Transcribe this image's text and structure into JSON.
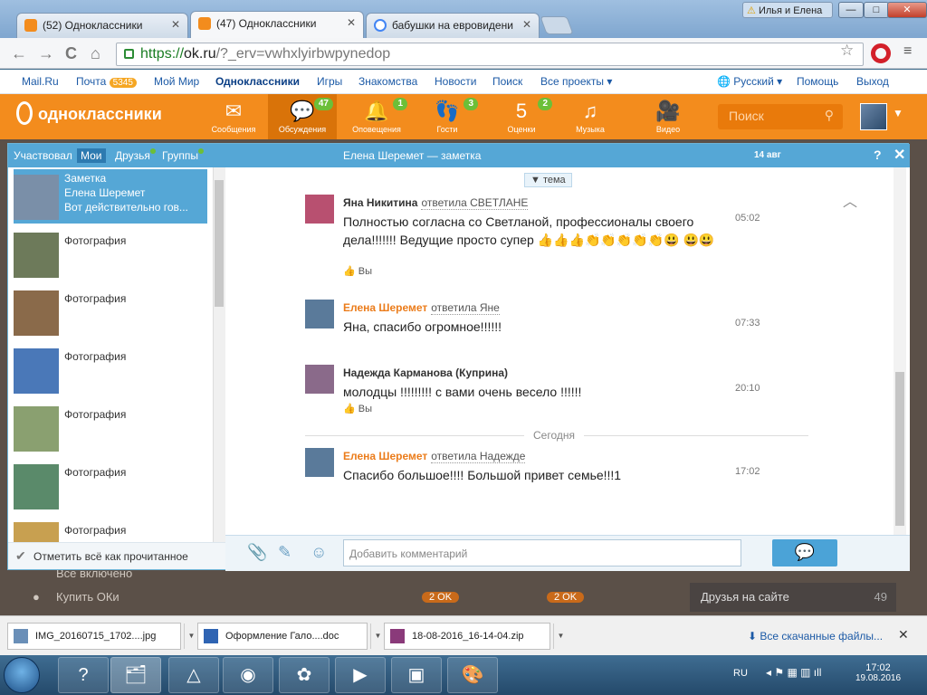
{
  "browser": {
    "tabs": [
      {
        "title": "(52) Одноклассники",
        "icon": "ok-favicon"
      },
      {
        "title": "(47) Одноклассники",
        "icon": "ok-favicon"
      },
      {
        "title": "бабушки на евровидени",
        "icon": "google-favicon"
      }
    ],
    "active_tab": 1,
    "window_user": "Илья и Елена",
    "window_buttons": {
      "minimize": "—",
      "maximize": "□",
      "close": "✕"
    },
    "url": {
      "scheme": "https://",
      "host": "ok.ru",
      "path": "/?_erv=vwhxlyirbwpynedop"
    },
    "nav": {
      "back": "←",
      "forward": "→",
      "reload": "C",
      "home": "⌂"
    },
    "star": "☆"
  },
  "mailru_bar": {
    "items": [
      "Mail.Ru",
      "Почта",
      "Мой Мир",
      "Одноклассники",
      "Игры",
      "Знакомства",
      "Новости",
      "Поиск",
      "Все проекты ▾"
    ],
    "pochta_count": "5345",
    "language": "Русский ▾",
    "help": "Помощь",
    "logout": "Выход"
  },
  "ok_header": {
    "logo_text": "одноклассники",
    "nav": [
      {
        "label": "Сообщения",
        "icon": "envelope-icon",
        "glyph": "✉",
        "count": ""
      },
      {
        "label": "Обсуждения",
        "icon": "chat-bubbles-icon",
        "glyph": "💬",
        "count": "47"
      },
      {
        "label": "Оповещения",
        "icon": "bell-icon",
        "glyph": "🔔",
        "count": "1"
      },
      {
        "label": "Гости",
        "icon": "footprints-icon",
        "glyph": "👣",
        "count": "3"
      },
      {
        "label": "Оценки",
        "icon": "rating-icon",
        "glyph": "5",
        "count": "2"
      },
      {
        "label": "Музыка",
        "icon": "music-icon",
        "glyph": "♫",
        "count": ""
      },
      {
        "label": "Видео",
        "icon": "video-camera-icon",
        "glyph": "🎥",
        "count": ""
      }
    ],
    "search_placeholder": "Поиск"
  },
  "discussions": {
    "tabs": [
      "Участвовал",
      "Мои",
      "Друзья",
      "Группы"
    ],
    "selected_tab": "Мои",
    "list": [
      {
        "line1": "Заметка",
        "line2": "Елена Шеремет",
        "line3": "Вот действительно гов...",
        "thumb_color": "#7a8fa8"
      },
      {
        "line1": "Фотография",
        "thumb_color": "#6d7a5a"
      },
      {
        "line1": "Фотография",
        "thumb_color": "#8a6a4a"
      },
      {
        "line1": "Фотография",
        "thumb_color": "#4a78b8"
      },
      {
        "line1": "Фотография",
        "thumb_color": "#8aa070"
      },
      {
        "line1": "Фотография",
        "thumb_color": "#5a8a6a"
      },
      {
        "line1": "Фотография",
        "thumb_color": "#c8a050"
      }
    ],
    "mark_all_read": "Отметить всё как прочитанное"
  },
  "conversation": {
    "title": "Елена Шеремет — заметка",
    "date": "14 авг",
    "help": "?",
    "close": "✕",
    "topic_button": "▼ тема",
    "messages": [
      {
        "author": "Яна Никитина",
        "reply": "ответила СВЕТЛАНЕ",
        "text": "Полностью согласна со Светланой, профессионалы своего дела!!!!!!! Ведущие просто супер 👍👍👍👏👏👏👏👏😃 😃😃",
        "time": "05:02",
        "like": "Вы",
        "author_color": "#333333"
      },
      {
        "author": "Елена Шеремет",
        "reply": "ответила Яне",
        "text": "Яна, спасибо огромное!!!!!!",
        "time": "07:33",
        "like": "",
        "author_color": "#eb7c1b"
      },
      {
        "author": "Надежда Карманова (Куприна)",
        "reply": "",
        "text": "молодцы !!!!!!!!! с вами очень весело !!!!!!",
        "time": "20:10",
        "like": "Вы",
        "author_color": "#333333"
      },
      {
        "author": "Елена Шеремет",
        "reply": "ответила Надежде",
        "text": "Спасибо большое!!!!  Большой привет семье!!!1",
        "time": "17:02",
        "like": "",
        "author_color": "#eb7c1b"
      }
    ],
    "day_separator": "Сегодня",
    "comment_placeholder": "Добавить комментарий"
  },
  "background_page": {
    "items": [
      "Все включено",
      "Купить ОКи"
    ],
    "friends_online_label": "Друзья на сайте",
    "friends_online_count": "49",
    "price_tags": [
      "2 OK",
      "2 OK"
    ]
  },
  "downloads": {
    "files": [
      "IMG_20160715_1702....jpg",
      "Оформление  Гало....doc",
      "18-08-2016_16-14-04.zip"
    ],
    "show_all": "Все скачанные файлы..."
  },
  "taskbar": {
    "language": "RU",
    "time": "17:02",
    "date": "19.08.2016"
  }
}
